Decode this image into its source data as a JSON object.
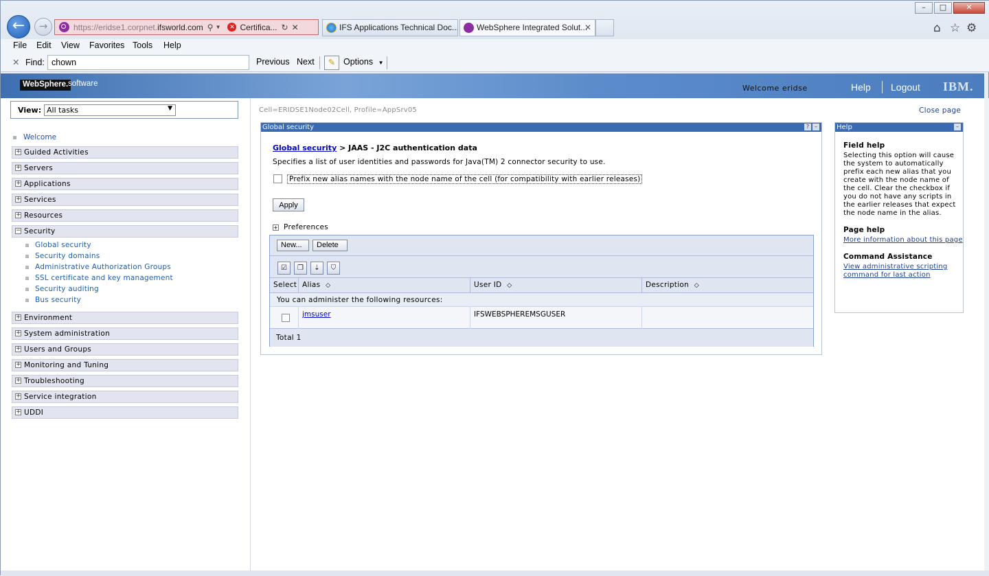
{
  "browser": {
    "window_controls": {
      "minimize": "–",
      "restore": "□",
      "close": "✕"
    },
    "address": {
      "scheme_host": "https://eridse1.corpnet.",
      "domain": "ifsworld.com",
      "cert_error": "Certifica..."
    },
    "tabs": [
      {
        "label": "IFS Applications Technical Doc..."
      },
      {
        "label": "WebSphere Integrated Solut...",
        "close": "✕"
      }
    ],
    "menu": [
      "File",
      "Edit",
      "View",
      "Favorites",
      "Tools",
      "Help"
    ],
    "find": {
      "label": "Find:",
      "value": "chown",
      "previous": "Previous",
      "next": "Next",
      "options": "Options"
    }
  },
  "banner": {
    "logo": "WebSphere.",
    "software": "software",
    "welcome": "Welcome eridse",
    "help": "Help",
    "logout": "Logout",
    "ibm": "IBM."
  },
  "sidebar": {
    "view_label": "View:",
    "view_value": "All tasks",
    "welcome": "Welcome",
    "groups": [
      {
        "label": "Guided Activities",
        "state": "+"
      },
      {
        "label": "Servers",
        "state": "+"
      },
      {
        "label": "Applications",
        "state": "+"
      },
      {
        "label": "Services",
        "state": "+"
      },
      {
        "label": "Resources",
        "state": "+"
      },
      {
        "label": "Security",
        "state": "−"
      },
      {
        "label": "Environment",
        "state": "+"
      },
      {
        "label": "System administration",
        "state": "+"
      },
      {
        "label": "Users and Groups",
        "state": "+"
      },
      {
        "label": "Monitoring and Tuning",
        "state": "+"
      },
      {
        "label": "Troubleshooting",
        "state": "+"
      },
      {
        "label": "Service integration",
        "state": "+"
      },
      {
        "label": "UDDI",
        "state": "+"
      }
    ],
    "security_items": [
      "Global security",
      "Security domains",
      "Administrative Authorization Groups",
      "SSL certificate and key management",
      "Security auditing",
      "Bus security"
    ]
  },
  "main": {
    "cell_info": "Cell=ERIDSE1Node02Cell, Profile=AppSrv05",
    "close_page": "Close page",
    "panel_title": "Global security",
    "panel_help_btn": "?",
    "panel_min_btn": "–",
    "breadcrumb_link": "Global security",
    "breadcrumb_rest": " > JAAS - J2C authentication data",
    "description": "Specifies a list of user identities and passwords for Java(TM) 2 connector security to use.",
    "prefix_label": "Prefix new alias names with the node name of the cell (for compatibility with earlier releases)",
    "apply": "Apply",
    "preferences": "Preferences",
    "table": {
      "buttons": [
        "New...",
        "Delete"
      ],
      "columns": [
        "Select",
        "Alias",
        "User ID",
        "Description"
      ],
      "admin_note": "You can administer the following resources:",
      "rows": [
        {
          "alias": "jmsuser",
          "user_id": "IFSWEBSPHEREMSGUSER",
          "description": ""
        }
      ],
      "total": "Total 1"
    }
  },
  "help": {
    "title": "Help",
    "field_help_title": "Field help",
    "field_help_text": "Selecting this option will cause the system to automatically prefix each new alias that you create with the node name of the cell. Clear the checkbox if you do not have any scripts in the earlier releases that expect the node name in the alias.",
    "page_help_title": "Page help",
    "page_help_link": "More information about this page",
    "cmd_title": "Command Assistance",
    "cmd_link": "View administrative scripting command for last action"
  }
}
